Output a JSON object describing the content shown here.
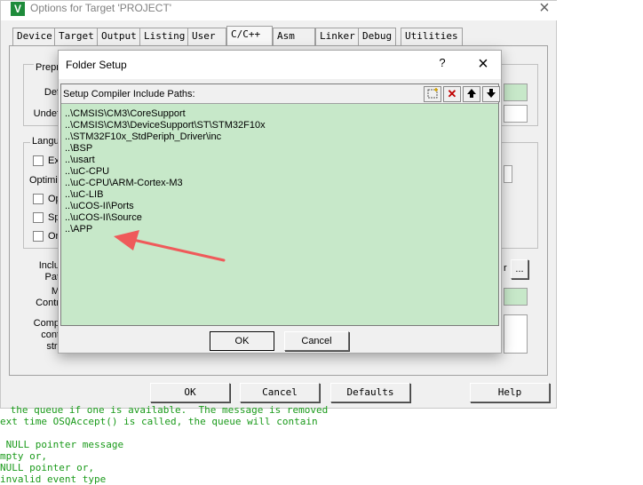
{
  "options_window": {
    "title": "Options for Target 'PROJECT'",
    "logo": "V",
    "close": "×",
    "tabs": [
      "Device",
      "Target",
      "Output",
      "Listing",
      "User",
      "C/C++",
      "Asm",
      "Linker",
      "Debug",
      "Utilities"
    ],
    "active_tab": "C/C++",
    "partial_labels": {
      "preprocessor": "Prepro",
      "define": "Def",
      "undefine": "Undef",
      "language": "Langu",
      "ex": "Ex",
      "optimization": "Optimiz",
      "op": "Op",
      "sp": "Sp",
      "on": "On",
      "include": "Inclu",
      "paths": "Pat",
      "misc": "M",
      "controls": "Contr",
      "compiler": "Comp",
      "control": "cont",
      "string": "stri",
      "browse_partial": "r",
      "browse_ellipsis": "..."
    },
    "buttons": {
      "ok": "OK",
      "cancel": "Cancel",
      "defaults": "Defaults",
      "help": "Help"
    }
  },
  "background_code": [
    " the queue if one is available.  The message is removed",
    "ext time OSQAccept() is called, the queue will contain",
    "",
    " NULL pointer message",
    "mpty or,",
    "NULL pointer or,",
    "invalid event type"
  ],
  "folder_setup": {
    "title": "Folder Setup",
    "help": "?",
    "close": "×",
    "header_label": "Setup Compiler Include Paths:",
    "toolbar": {
      "new": "⬚",
      "delete": "✕",
      "up": "🡑",
      "down": "🡓"
    },
    "paths": [
      "..\\CMSIS\\CM3\\CoreSupport",
      "..\\CMSIS\\CM3\\DeviceSupport\\ST\\STM32F10x",
      "..\\STM32F10x_StdPeriph_Driver\\inc",
      "..\\BSP",
      "..\\usart",
      "..\\uC-CPU",
      "..\\uC-CPU\\ARM-Cortex-M3",
      "..\\uC-LIB",
      "..\\uCOS-II\\Ports",
      "..\\uCOS-II\\Source",
      "..\\APP"
    ],
    "buttons": {
      "ok": "OK",
      "cancel": "Cancel"
    }
  },
  "colors": {
    "list_background": "#c7e8c9",
    "annotation_arrow": "#ef5a5a",
    "code_green": "#1a9a1a"
  }
}
